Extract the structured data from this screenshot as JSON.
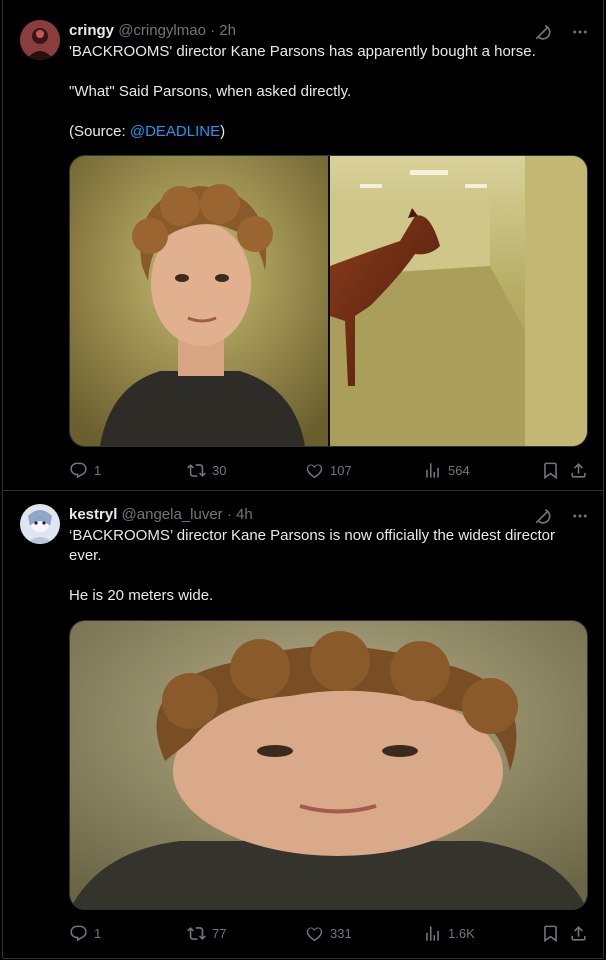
{
  "tweets": [
    {
      "author": {
        "name": "cringy",
        "handle": "@cringylmao",
        "time": "2h"
      },
      "text": {
        "line1": "'BACKROOMS' director Kane Parsons has apparently bought a horse.",
        "line2": "\"What\" Said Parsons, when asked directly.",
        "source_prefix": "(Source: ",
        "source_link": "@DEADLINE",
        "source_suffix": ")"
      },
      "stats": {
        "replies": "1",
        "reposts": "30",
        "likes": "107",
        "views": "564"
      }
    },
    {
      "author": {
        "name": "kestryl",
        "handle": "@angela_luver",
        "time": "4h"
      },
      "text": {
        "line1": "‘BACKROOMS’ director Kane Parsons is now officially the widest director ever.",
        "line2": "He is 20 meters wide."
      },
      "stats": {
        "replies": "1",
        "reposts": "77",
        "likes": "331",
        "views": "1.6K"
      }
    }
  ],
  "separator": "·",
  "icons": [
    "grok-icon",
    "more-icon",
    "reply-icon",
    "repost-icon",
    "like-icon",
    "views-icon",
    "bookmark-icon",
    "share-icon"
  ],
  "colors": {
    "background": "#000000",
    "text": "#e7e9ea",
    "muted": "#71767b",
    "link": "#1d9bf0",
    "border": "#2f3336"
  }
}
